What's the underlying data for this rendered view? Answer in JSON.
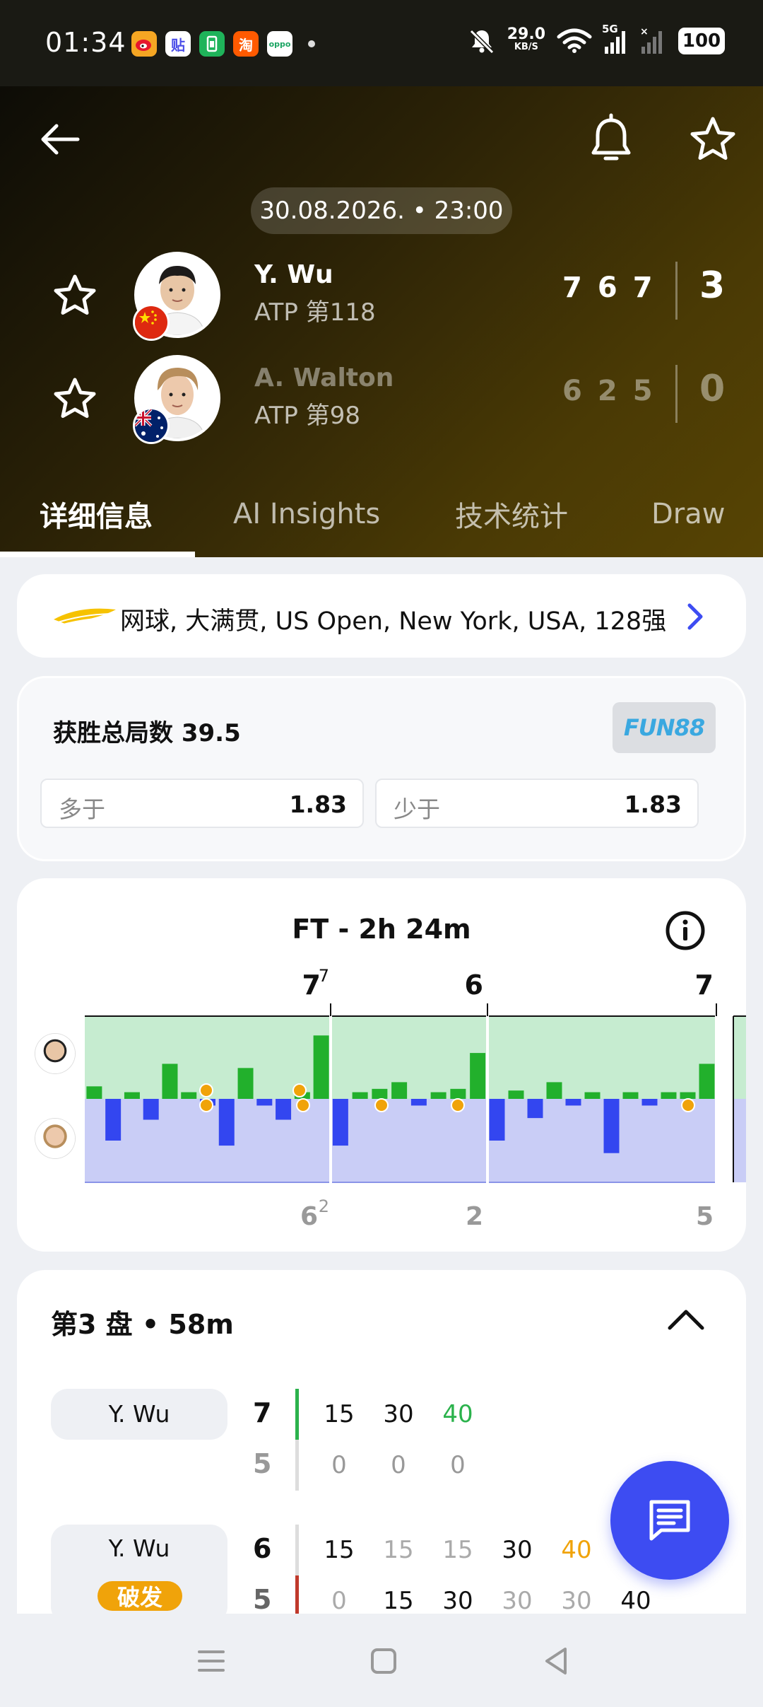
{
  "status_bar": {
    "time": "01:34",
    "apps": [
      "weibo-icon",
      "tieba-icon",
      "wallet-icon",
      "taobao-icon",
      "oppo-icon"
    ],
    "net_speed": "29.0",
    "net_unit": "KB/S",
    "network": "5G",
    "battery": "100"
  },
  "header": {
    "datetime": "30.08.2026. • 23:00",
    "players": [
      {
        "name": "Y. Wu",
        "rank": "ATP 第118",
        "sets": [
          "7",
          "6",
          "7"
        ],
        "total": "3",
        "flag": "china",
        "winner": true
      },
      {
        "name": "A. Walton",
        "rank": "ATP 第98",
        "sets": [
          "6",
          "2",
          "5"
        ],
        "total": "0",
        "flag": "australia",
        "winner": false
      }
    ],
    "tabs": [
      {
        "label": "详细信息",
        "active": true
      },
      {
        "label": "AI Insights",
        "active": false
      },
      {
        "label": "技术统计",
        "active": false
      },
      {
        "label": "Draw",
        "active": false
      }
    ]
  },
  "tournament": {
    "text": "网球, 大满贯, US Open, New York, USA, 128强",
    "logo": "us-open-logo"
  },
  "odds": {
    "title": "获胜总局数 39.5",
    "bookmaker": "FUN88",
    "over_label": "多于",
    "over_value": "1.83",
    "under_label": "少于",
    "under_value": "1.83"
  },
  "momentum": {
    "title": "FT - 2h 24m",
    "top_labels": [
      {
        "text": "7",
        "sup": "7"
      },
      {
        "text": "6",
        "sup": ""
      },
      {
        "text": "7",
        "sup": ""
      }
    ],
    "bottom_labels": [
      {
        "text": "6",
        "sup": "2"
      },
      {
        "text": "2",
        "sup": ""
      },
      {
        "text": "5",
        "sup": ""
      }
    ]
  },
  "chart_data": {
    "type": "bar",
    "title": "FT - 2h 24m",
    "description_series": [
      {
        "name": "Y. Wu",
        "sets": [
          "7",
          "6",
          "7"
        ]
      },
      {
        "name": "A. Walton",
        "sets": [
          "6",
          "2",
          "5"
        ]
      }
    ],
    "sets": [
      {
        "values": [
          0.15,
          -0.5,
          0.08,
          -0.25,
          0.42,
          0.08,
          -0.08,
          -0.56,
          0.37,
          -0.08,
          -0.25,
          0.08,
          0.76
        ]
      },
      {
        "values": [
          -0.56,
          0.08,
          0.12,
          0.2,
          -0.08,
          0.08,
          0.12,
          0.55
        ]
      },
      {
        "values": [
          -0.5,
          0.1,
          -0.23,
          0.2,
          -0.08,
          0.08,
          -0.65,
          0.08,
          -0.08,
          0.08,
          0.08,
          0.42
        ]
      }
    ],
    "ylim": [
      -1,
      1
    ]
  },
  "set_detail": {
    "title": "第3 盘 • 58m",
    "games": [
      {
        "server": "Y. Wu",
        "break": "",
        "score_top": "7",
        "score_bottom": "5",
        "bar_color": "#2bb24c",
        "points_top": [
          "15",
          "30",
          "40"
        ],
        "points_bottom": [
          "0",
          "0",
          "0"
        ]
      },
      {
        "server": "Y. Wu",
        "break": "破发",
        "score_top": "6",
        "score_bottom": "5",
        "bar_color": "#c0392b",
        "points_top": [
          "15",
          "15",
          "15",
          "30",
          "40",
          ""
        ],
        "points_bottom": [
          "0",
          "15",
          "30",
          "30",
          "30",
          "40"
        ]
      }
    ]
  }
}
